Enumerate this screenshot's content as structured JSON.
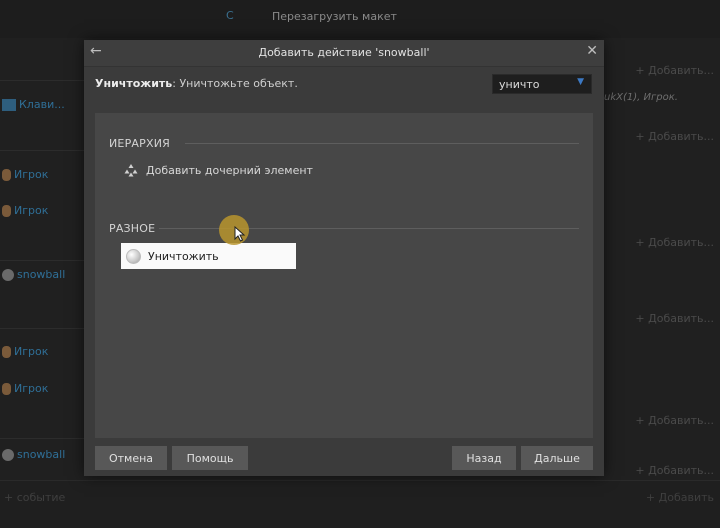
{
  "background": {
    "topbar": {
      "tab_label": "С",
      "restart_label": "Перезагрузить макет"
    },
    "left_objects": [
      {
        "label": "Клави...",
        "kind": "keyboard"
      },
      {
        "label": "Игрок",
        "kind": "person"
      },
      {
        "label": "Игрок",
        "kind": "person"
      },
      {
        "label": "snowball",
        "kind": "ball"
      },
      {
        "label": "Игрок",
        "kind": "person"
      },
      {
        "label": "Игрок",
        "kind": "person"
      },
      {
        "label": "snowball",
        "kind": "ball"
      }
    ],
    "right_condition": "ukX(1), Игрок.",
    "add_label": "+ Добавить...",
    "bottom_event": "+ событие",
    "bottom_add": "+ Добавить"
  },
  "dialog": {
    "title": "Добавить действие 'snowball'",
    "description_bold": "Уничтожить",
    "description_rest": ": Уничтожьте объект.",
    "search_value": "уничто",
    "search_icon": "chevron-down-icon",
    "sections": [
      {
        "title": "ИЕРАРХИЯ",
        "items": [
          {
            "label": "Добавить дочерний элемент",
            "icon": "hierarchy-icon"
          }
        ]
      },
      {
        "title": "РАЗНОЕ",
        "items": [
          {
            "label": "Уничтожить",
            "icon": "snowball-icon",
            "selected": true
          }
        ]
      }
    ],
    "buttons": {
      "cancel": "Отмена",
      "help": "Помощь",
      "back": "Назад",
      "next": "Дальше"
    },
    "colors": {
      "accent": "#3c79c4",
      "cursor_highlight": "#b8952e"
    }
  }
}
